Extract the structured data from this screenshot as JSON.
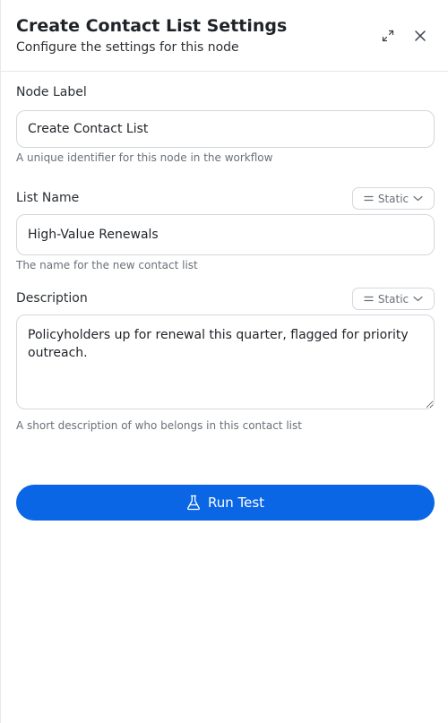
{
  "header": {
    "title": "Create Contact List Settings",
    "subtitle": "Configure the settings for this node",
    "expand_icon": "expand-icon",
    "close_icon": "close-icon"
  },
  "fields": {
    "node_label": {
      "label": "Node Label",
      "value": "Create Contact List",
      "help": "A unique identifier for this node in the workflow"
    },
    "list_name": {
      "label": "List Name",
      "mode": "Static",
      "value": "High-Value Renewals",
      "help": "The name for the new contact list"
    },
    "description": {
      "label": "Description",
      "mode": "Static",
      "value": "Policyholders up for renewal this quarter, flagged for priority outreach.",
      "help": "A short description of who belongs in this contact list"
    }
  },
  "actions": {
    "run_test_label": "Run Test",
    "run_test_icon": "flask-icon"
  },
  "colors": {
    "primary": "#0a66e4",
    "border": "#d4d7dc",
    "muted_text": "#6a7079"
  }
}
